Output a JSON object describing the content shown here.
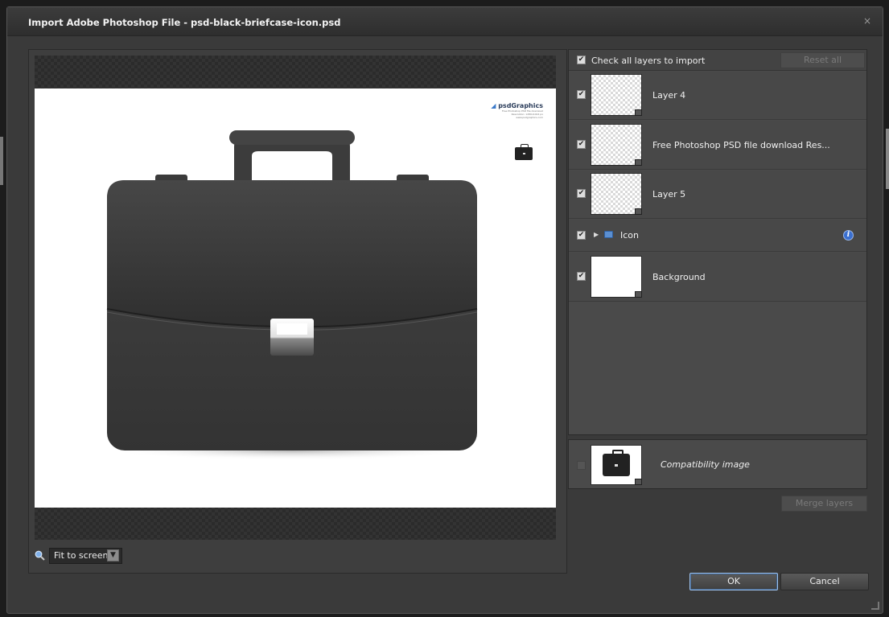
{
  "dialog": {
    "title": "Import Adobe Photoshop File - psd-black-briefcase-icon.psd",
    "close_label": "×"
  },
  "preview": {
    "brand_name": "psdGraphics",
    "brand_lines": [
      "Free Photoshop PSD file download",
      "Resolution: 1280x1024 px",
      "www.psdgraphics.com"
    ]
  },
  "zoom": {
    "value": "Fit to screen",
    "icon": "magnifier-icon",
    "dropdown_icon": "chevron-down-icon"
  },
  "layers": {
    "check_all_label": "Check all layers to import",
    "check_all_checked": true,
    "reset_all_label": "Reset all",
    "items": [
      {
        "name": "Layer 4",
        "checked": true,
        "type": "layer"
      },
      {
        "name": "Free Photoshop PSD file download Res...",
        "checked": true,
        "type": "layer"
      },
      {
        "name": "Layer 5",
        "checked": true,
        "type": "layer"
      },
      {
        "name": "Icon",
        "checked": true,
        "type": "group"
      },
      {
        "name": "Background",
        "checked": true,
        "type": "layer"
      }
    ]
  },
  "compatibility": {
    "label": "Compatibility image",
    "checked": false
  },
  "buttons": {
    "merge_layers": "Merge layers",
    "ok": "OK",
    "cancel": "Cancel"
  }
}
